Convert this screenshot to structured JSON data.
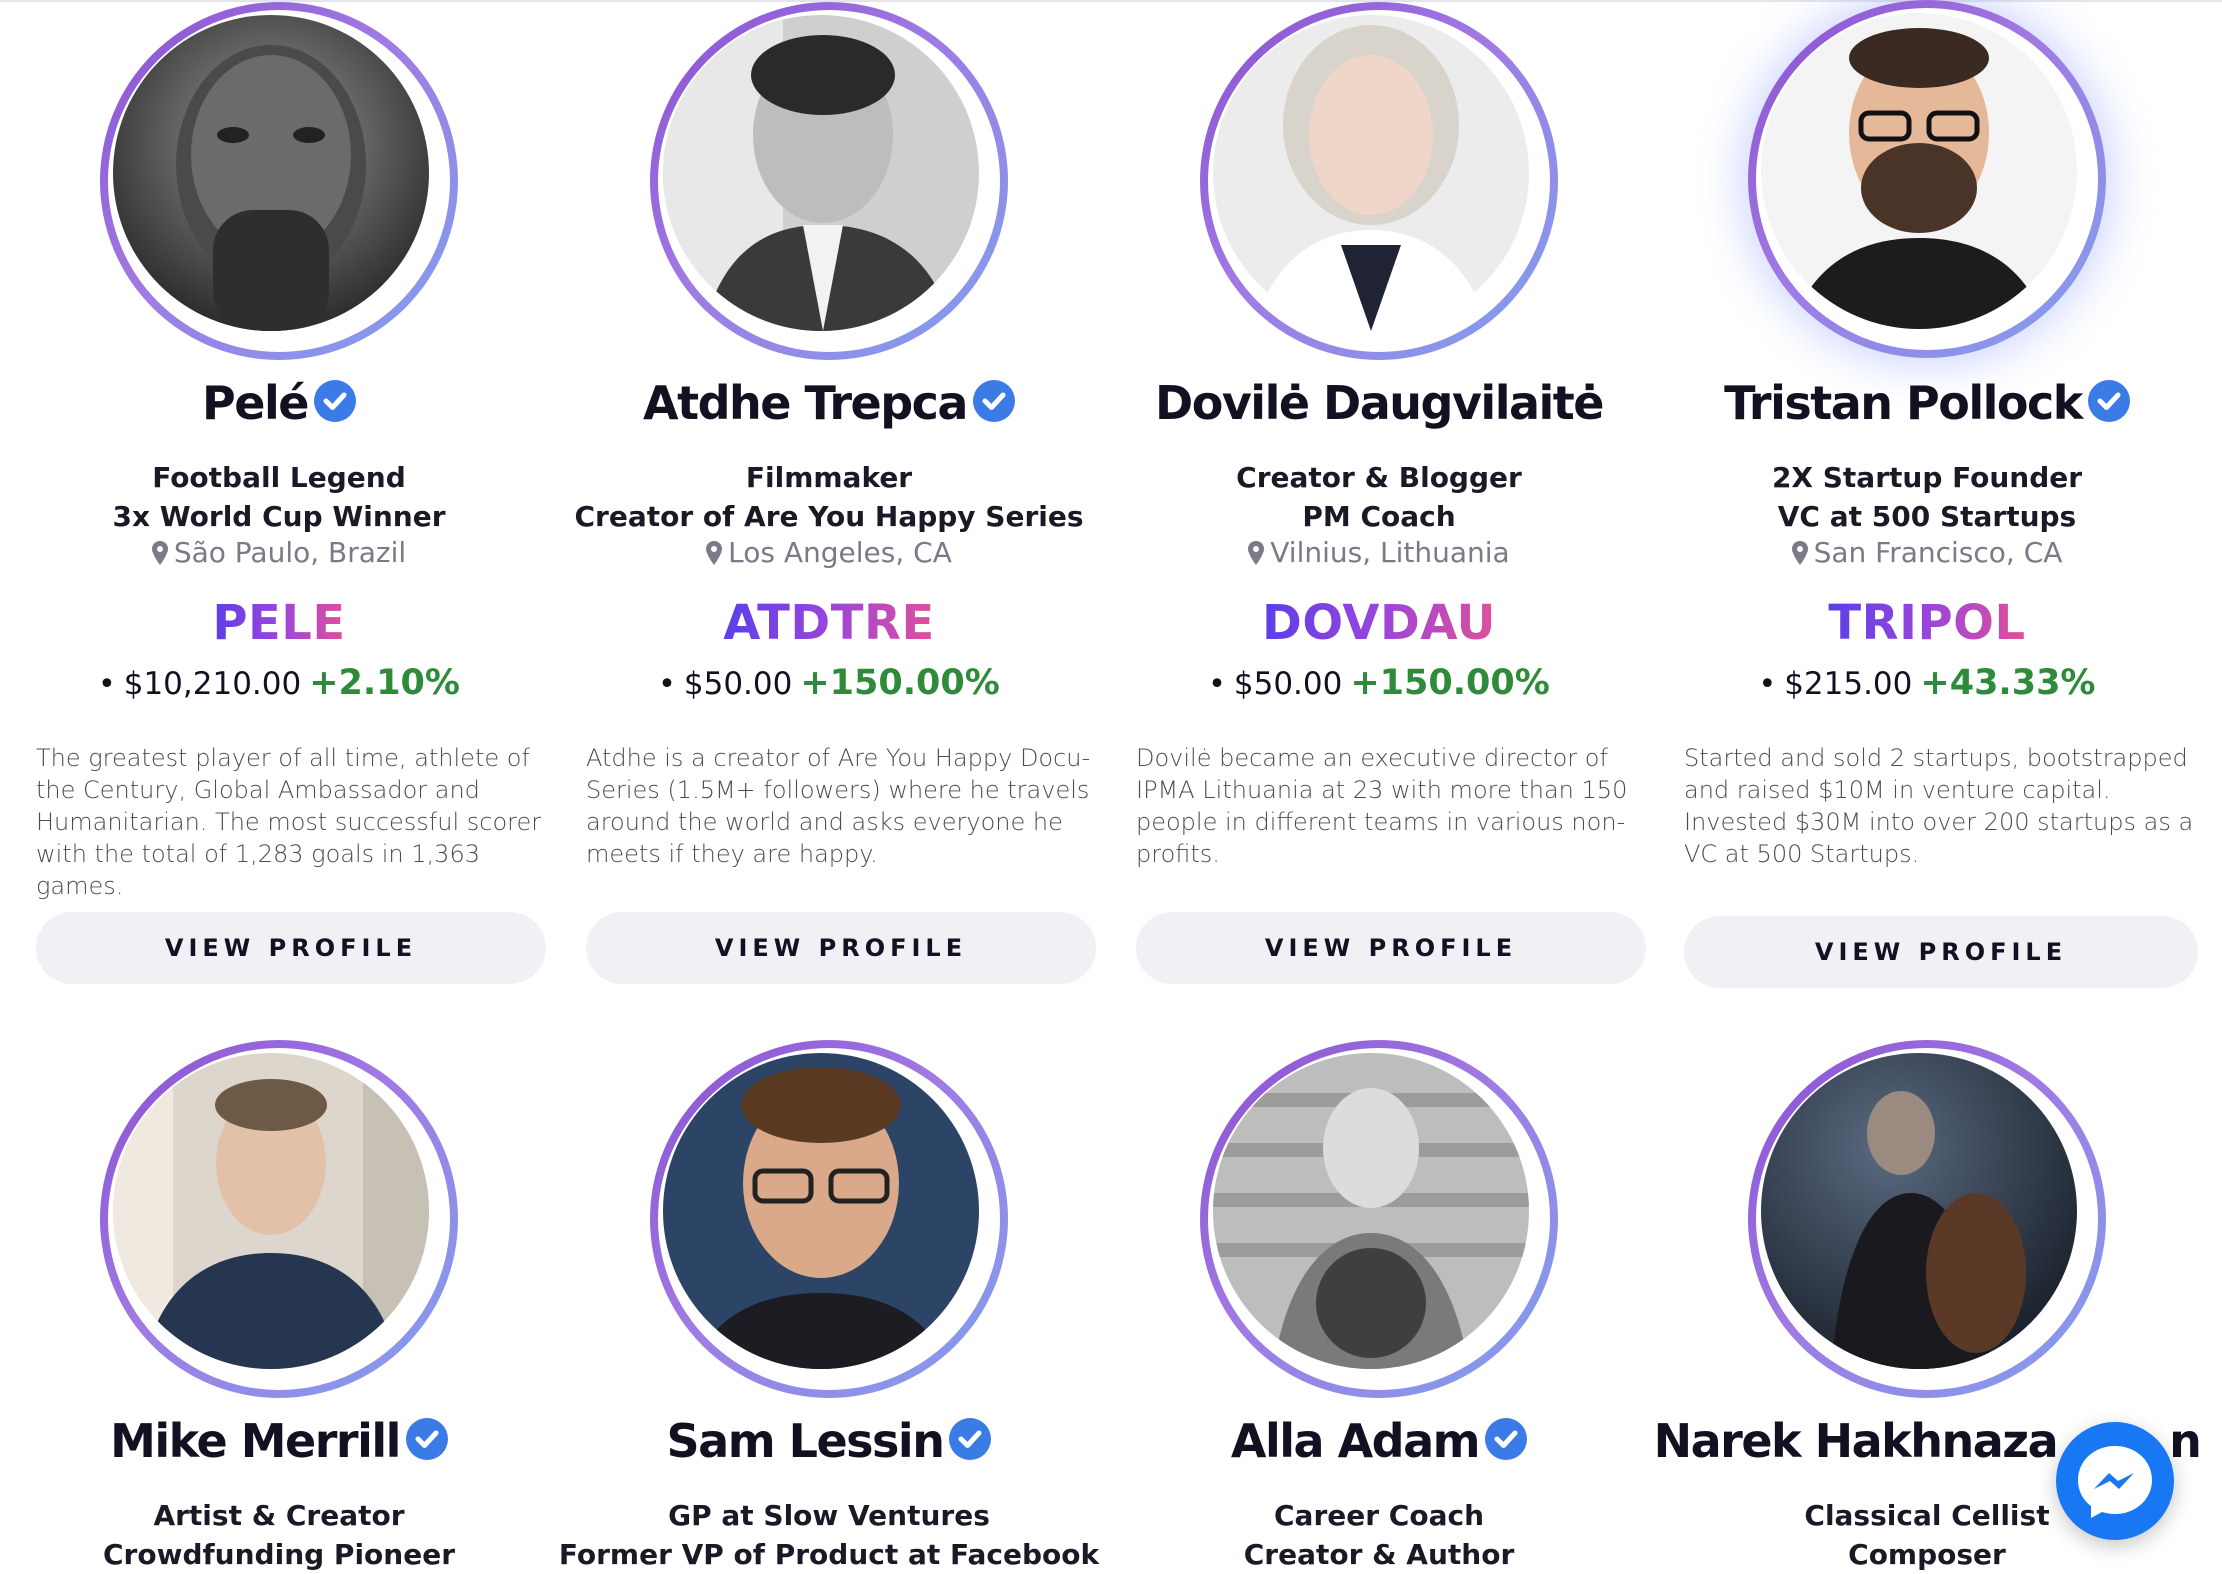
{
  "profiles": [
    {
      "name": "Pelé",
      "roles": [
        "Football Legend",
        "3x World Cup Winner"
      ],
      "location": "São Paulo, Brazil",
      "ticker": "PELE",
      "price": "$10,210.00",
      "change": "+2.10%",
      "bio": "The greatest player of all time, athlete of the Century, Global Ambassador and Humanitarian. The most successful scorer with the total of 1,283 goals in 1,363 games.",
      "button": "VIEW PROFILE"
    },
    {
      "name": "Atdhe Trepca",
      "roles": [
        "Filmmaker",
        "Creator of Are You Happy Series"
      ],
      "location": "Los Angeles, CA",
      "ticker": "ATDTRE",
      "price": "$50.00",
      "change": "+150.00%",
      "bio": "Atdhe is a creator of Are You Happy Docu-Series (1.5M+ followers) where he travels around the world and asks everyone he meets if they are happy.",
      "button": "VIEW PROFILE"
    },
    {
      "name": "Dovilė Daugvilaitė",
      "roles": [
        "Creator & Blogger",
        "PM Coach"
      ],
      "location": "Vilnius, Lithuania",
      "ticker": "DOVDAU",
      "price": "$50.00",
      "change": "+150.00%",
      "bio": "Dovilė became an executive director of IPMA Lithuania at 23 with more than 150 people in different teams in various non-profits.",
      "button": "VIEW PROFILE"
    },
    {
      "name": "Tristan Pollock",
      "roles": [
        "2X Startup Founder",
        "VC at 500 Startups"
      ],
      "location": "San Francisco, CA",
      "ticker": "TRIPOL",
      "price": "$215.00",
      "change": "+43.33%",
      "bio": "Started and sold 2 startups, bootstrapped and raised $10M in venture capital. Invested $30M into over 200 startups as a VC at 500 Startups.",
      "button": "VIEW PROFILE"
    },
    {
      "name": "Mike Merrill",
      "roles": [
        "Artist & Creator",
        "Crowdfunding Pioneer"
      ]
    },
    {
      "name": "Sam Lessin",
      "roles": [
        "GP at Slow Ventures",
        "Former VP of Product at Facebook"
      ]
    },
    {
      "name": "Alla Adam",
      "roles": [
        "Career Coach",
        "Creator & Author"
      ]
    },
    {
      "name": "Narek Hakhnaza",
      "name_tail": "n",
      "roles": [
        "Classical Cellist",
        "Composer"
      ]
    }
  ],
  "colors": {
    "verified": "#3b7be6",
    "change_positive": "#2e8b3a",
    "ring_start": "#8a4fd0",
    "ring_end": "#7fa2ee",
    "ticker_start": "#5b3fe8",
    "ticker_end": "#e0509a",
    "button_bg": "#f0f1f5",
    "messenger": "#1877f2"
  },
  "icons": {
    "verified": "verified-check-icon",
    "location": "map-pin-icon",
    "messenger": "messenger-icon"
  }
}
